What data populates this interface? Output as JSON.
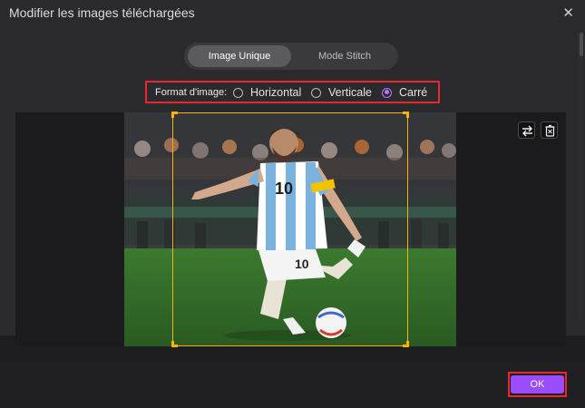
{
  "dialog": {
    "title": "Modifier les images téléchargées",
    "close_glyph": "✕"
  },
  "mode": {
    "tabs": [
      {
        "label": "Image Unique",
        "active": true
      },
      {
        "label": "Mode Stitch",
        "active": false
      }
    ]
  },
  "format": {
    "label": "Format d'image:",
    "options": [
      {
        "label": "Horizontal",
        "checked": false
      },
      {
        "label": "Verticale",
        "checked": false
      },
      {
        "label": "Carré",
        "checked": true
      }
    ]
  },
  "preview": {
    "tools": [
      {
        "name": "swap-icon"
      },
      {
        "name": "delete-icon"
      }
    ]
  },
  "footer": {
    "ok_label": "OK"
  },
  "colors": {
    "accent": "#9b4dfd",
    "crop_frame": "#f5b400",
    "highlight_box": "#e8282e"
  }
}
